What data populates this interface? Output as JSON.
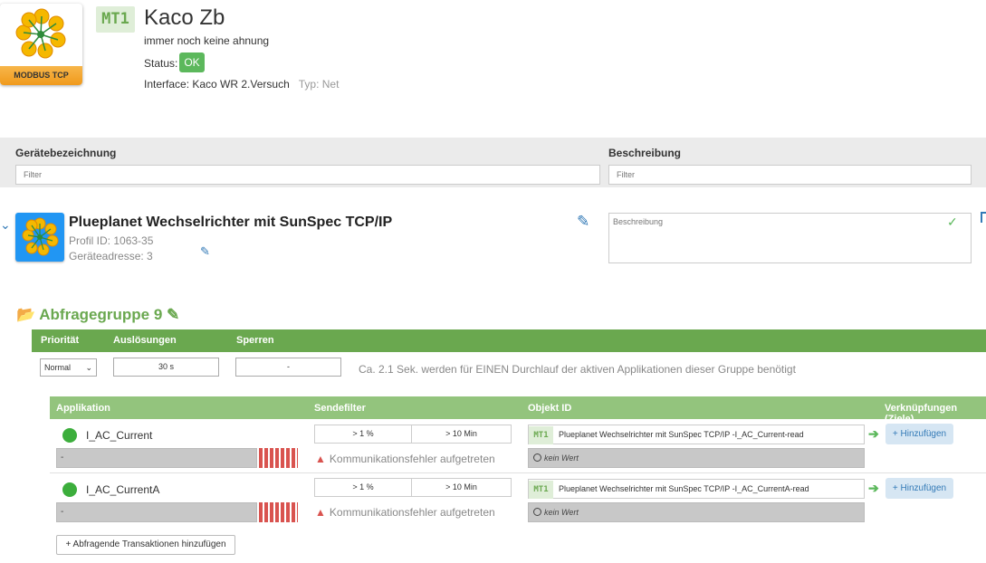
{
  "header": {
    "logo_label": "MODBUS TCP",
    "badge": "MT1",
    "title": "Kaco Zb",
    "subtitle": "immer noch keine ahnung",
    "status_label": "Status:",
    "status_value": "OK",
    "interface_text": "Interface: Kaco WR 2.Versuch",
    "type_text": "Typ: Net"
  },
  "filters": {
    "col1_label": "Gerätebezeichnung",
    "col1_placeholder": "Filter",
    "col2_label": "Beschreibung",
    "col2_placeholder": "Filter"
  },
  "profile": {
    "title": "Plueplanet Wechselrichter mit SunSpec TCP/IP",
    "profile_id": "Profil ID: 1063-35",
    "address": "Geräteadresse: 3",
    "description_placeholder": "Beschreibung"
  },
  "group": {
    "title": "Abfragegruppe 9",
    "headers": [
      "Priorität",
      "Auslösungen",
      "Sperren"
    ],
    "priority": "Normal",
    "trigger": "30 s",
    "lock": "-",
    "hint": "Ca. 2.1 Sek. werden für EINEN Durchlauf der aktiven Applikationen dieser Gruppe benötigt"
  },
  "apps": {
    "headers": [
      "Applikation",
      "Sendefilter",
      "Objekt ID",
      "Verknüpfungen (Ziele)"
    ],
    "rows": [
      {
        "name": "I_AC_Current",
        "value": "-",
        "filter_pct": "> 1 %",
        "filter_time": "> 10 Min",
        "error": "Kommunikationsfehler aufgetreten",
        "obj_badge": "MT1",
        "obj_id": "Plueplanet Wechselrichter mit SunSpec TCP/IP -I_AC_Current-read",
        "no_value": "kein Wert",
        "add_label": "+ Hinzufügen"
      },
      {
        "name": "I_AC_CurrentA",
        "value": "-",
        "filter_pct": "> 1 %",
        "filter_time": "> 10 Min",
        "error": "Kommunikationsfehler aufgetreten",
        "obj_badge": "MT1",
        "obj_id": "Plueplanet Wechselrichter mit SunSpec TCP/IP -I_AC_CurrentA-read",
        "no_value": "kein Wert",
        "add_label": "+ Hinzufügen"
      }
    ],
    "add_transactions": "+ Abfragende Transaktionen hinzufügen"
  },
  "colors": {
    "green_dark": "#6aa84f",
    "green_light": "#93c47d",
    "ok_green": "#5cb85c",
    "error_red": "#d9534f",
    "link_blue": "#337ab7"
  }
}
